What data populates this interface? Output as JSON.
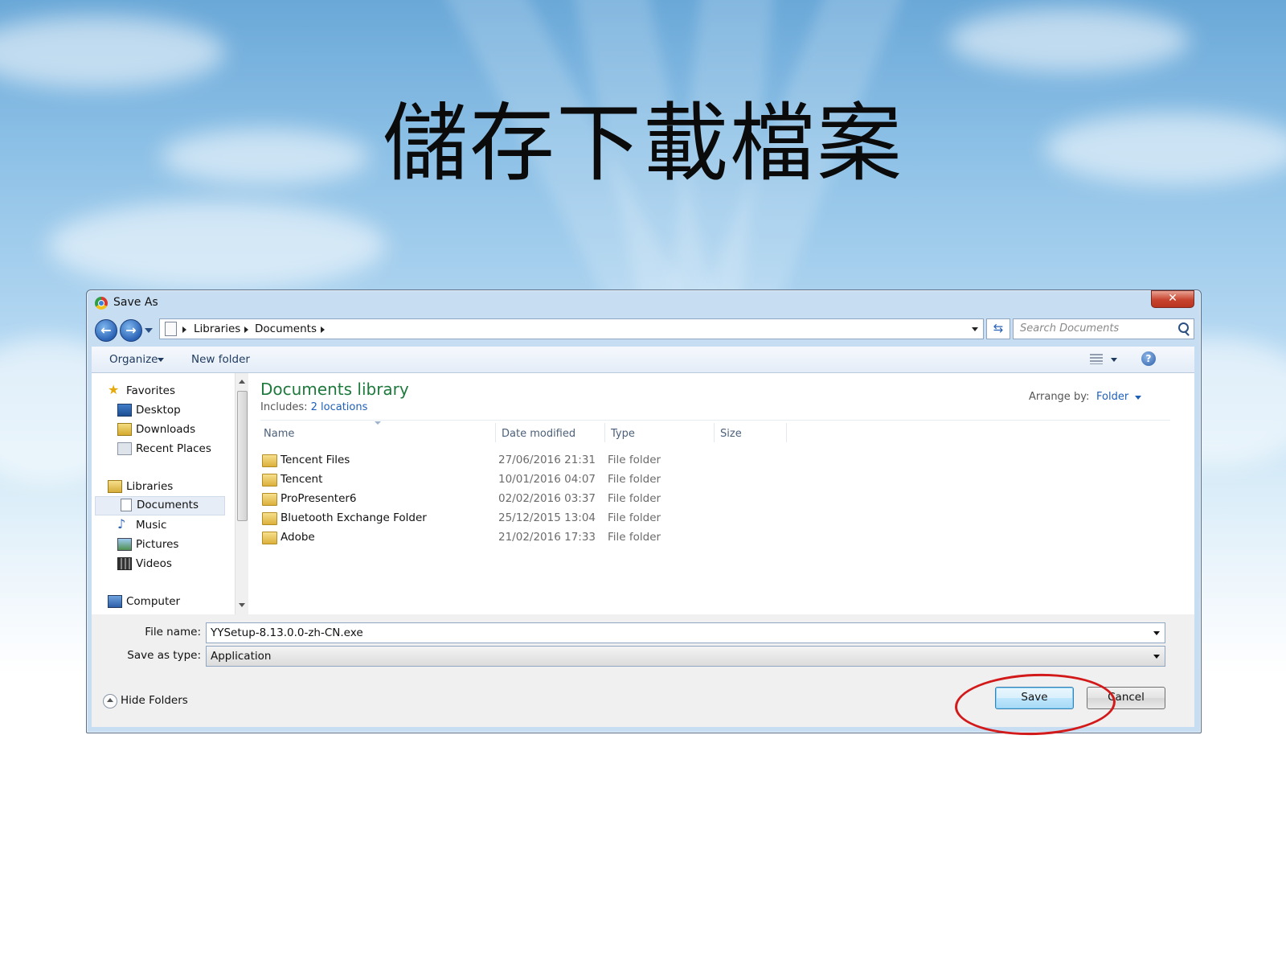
{
  "slide": {
    "title": "儲存下載檔案"
  },
  "dialog": {
    "title": "Save As",
    "close_label": "✕",
    "nav": {
      "back_icon": "back-arrow-icon",
      "forward_icon": "forward-arrow-icon"
    },
    "breadcrumb": [
      "Libraries",
      "Documents"
    ],
    "search_placeholder": "Search Documents",
    "toolbar": {
      "organize": "Organize",
      "new_folder": "New folder",
      "help": "?"
    },
    "sidebar": {
      "favorites": "Favorites",
      "favorites_items": [
        "Desktop",
        "Downloads",
        "Recent Places"
      ],
      "libraries": "Libraries",
      "libraries_items": [
        "Documents",
        "Music",
        "Pictures",
        "Videos"
      ],
      "computer": "Computer",
      "selected": "Documents"
    },
    "library": {
      "title": "Documents library",
      "includes_label": "Includes:",
      "includes_link": "2 locations",
      "arrange_label": "Arrange by:",
      "arrange_value": "Folder"
    },
    "columns": [
      "Name",
      "Date modified",
      "Type",
      "Size"
    ],
    "rows": [
      {
        "name": "Tencent Files",
        "date": "27/06/2016 21:31",
        "type": "File folder"
      },
      {
        "name": "Tencent",
        "date": "10/01/2016 04:07",
        "type": "File folder"
      },
      {
        "name": "ProPresenter6",
        "date": "02/02/2016 03:37",
        "type": "File folder"
      },
      {
        "name": "Bluetooth Exchange Folder",
        "date": "25/12/2015 13:04",
        "type": "File folder"
      },
      {
        "name": "Adobe",
        "date": "21/02/2016 17:33",
        "type": "File folder"
      }
    ],
    "file_name_label": "File name:",
    "file_name_value": "YYSetup-8.13.0.0-zh-CN.exe",
    "save_type_label": "Save as type:",
    "save_type_value": "Application",
    "hide_folders": "Hide Folders",
    "save_button": "Save",
    "cancel_button": "Cancel"
  },
  "colors": {
    "library_title": "#1e7a3c",
    "link": "#1e5fb8",
    "highlight_ring": "#d21a1a"
  }
}
